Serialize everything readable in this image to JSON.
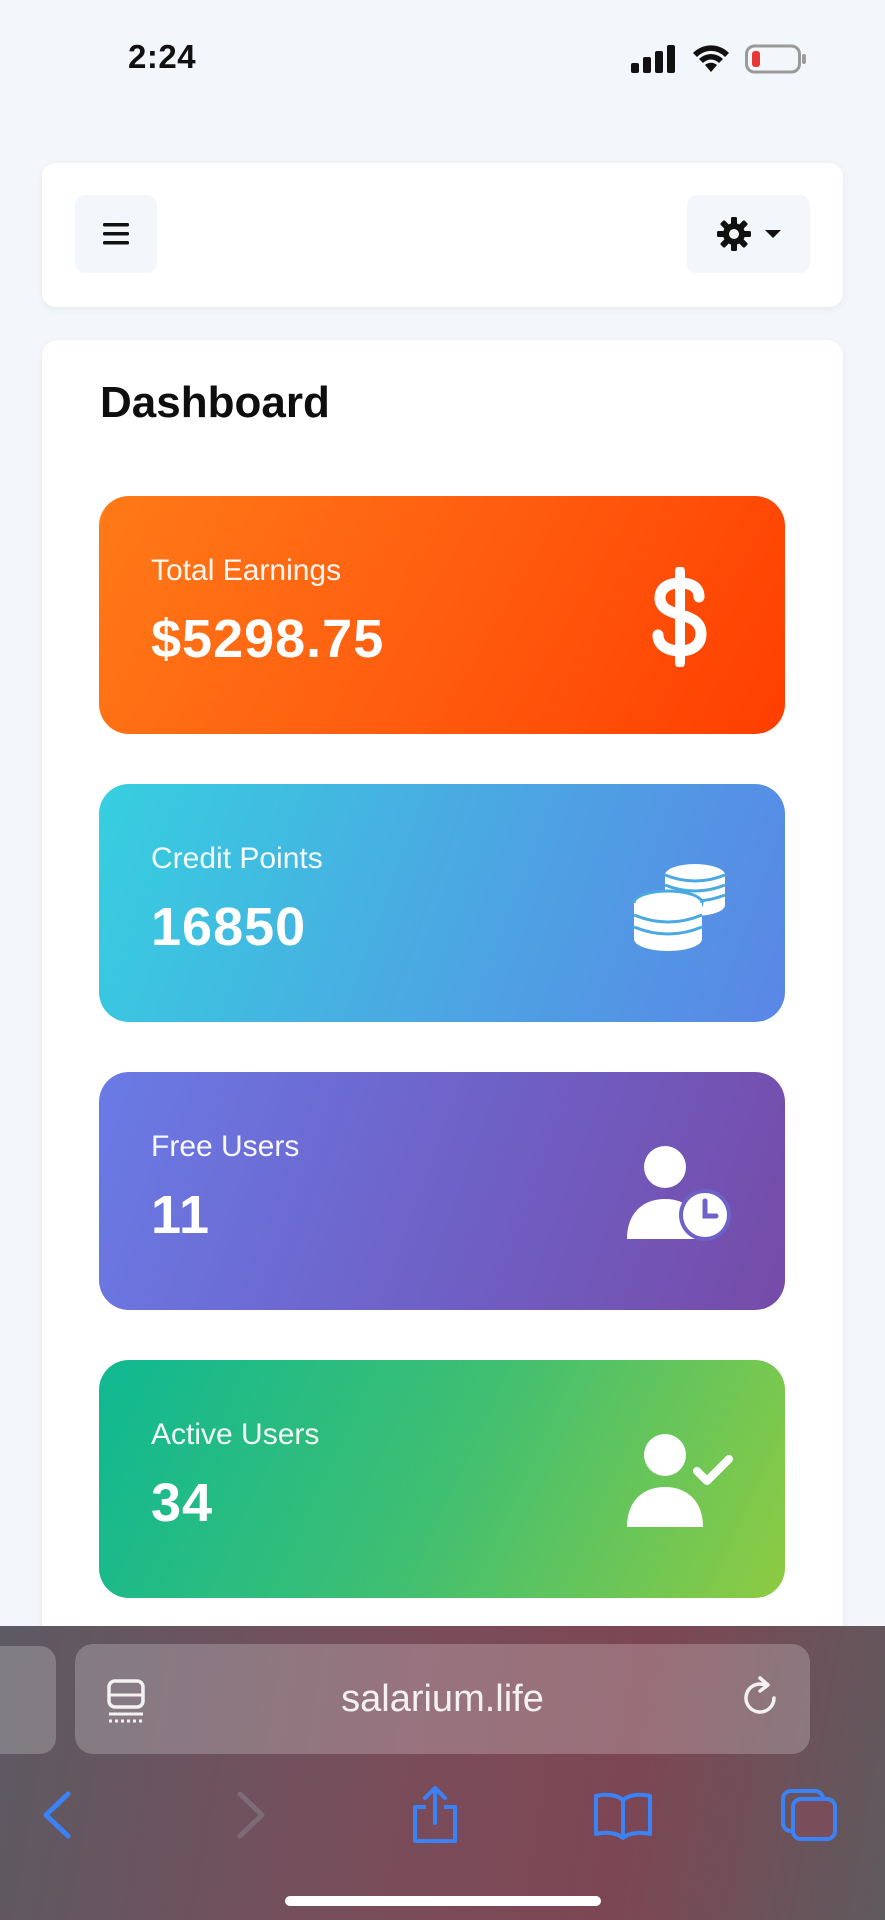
{
  "status_bar": {
    "time": "2:24",
    "icons": [
      "cellular-signal-icon",
      "wifi-icon",
      "battery-low-icon"
    ],
    "battery_color": "#e53935"
  },
  "nav": {
    "menu_icon": "hamburger-icon",
    "settings_icon": "gear-icon",
    "settings_caret": "caret-down-icon"
  },
  "dashboard": {
    "title": "Dashboard",
    "cards": [
      {
        "label": "Total Earnings",
        "value": "$5298.75",
        "icon": "dollar-icon",
        "colors": [
          "#ff7a18",
          "#ff3e00"
        ]
      },
      {
        "label": "Credit Points",
        "value": "16850",
        "icon": "coins-icon",
        "colors": [
          "#36cfe0",
          "#5a86e6"
        ]
      },
      {
        "label": "Free Users",
        "value": "11",
        "icon": "user-clock-icon",
        "colors": [
          "#6a7be6",
          "#764ba8"
        ]
      },
      {
        "label": "Active Users",
        "value": "34",
        "icon": "user-check-icon",
        "colors": [
          "#0fb892",
          "#8ecb42"
        ]
      }
    ]
  },
  "browser": {
    "url": "salarium.life",
    "accent_color": "#3b82f6",
    "toolbar_icons": [
      "back-icon",
      "forward-icon",
      "share-icon",
      "bookmarks-icon",
      "tabs-icon"
    ]
  }
}
